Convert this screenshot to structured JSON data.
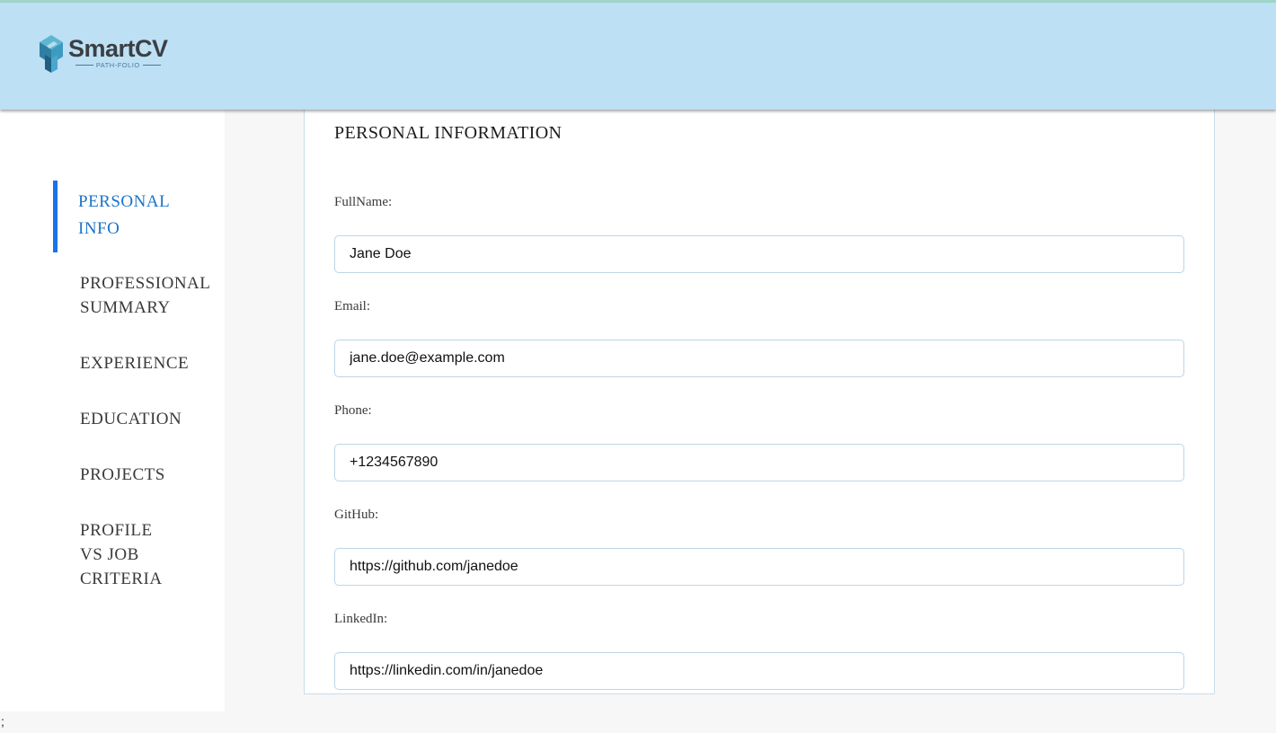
{
  "header": {
    "logo_name": "SmartCV",
    "logo_tagline": "PATH-FOLIO",
    "logo_icon": "smartcv-cube-logo",
    "background_color": "#bde0f4"
  },
  "sidebar": {
    "items": [
      {
        "label": "PERSONAL\nINFO",
        "active": true
      },
      {
        "label": "PROFESSIONAL\nSUMMARY",
        "active": false
      },
      {
        "label": "EXPERIENCE",
        "active": false
      },
      {
        "label": "EDUCATION",
        "active": false
      },
      {
        "label": "PROJECTS",
        "active": false
      },
      {
        "label": "PROFILE\nVS JOB\nCRITERIA",
        "active": false
      }
    ],
    "active_color": "#1a73c9"
  },
  "form": {
    "title": "PERSONAL INFORMATION",
    "fields": [
      {
        "label": "FullName:",
        "value": "Jane Doe"
      },
      {
        "label": "Email:",
        "value": "jane.doe@example.com"
      },
      {
        "label": "Phone:",
        "value": "+1234567890"
      },
      {
        "label": "GitHub:",
        "value": "https://github.com/janedoe"
      },
      {
        "label": "LinkedIn:",
        "value": "https://linkedin.com/in/janedoe"
      }
    ]
  },
  "footer": {
    "stray_text": ";"
  }
}
